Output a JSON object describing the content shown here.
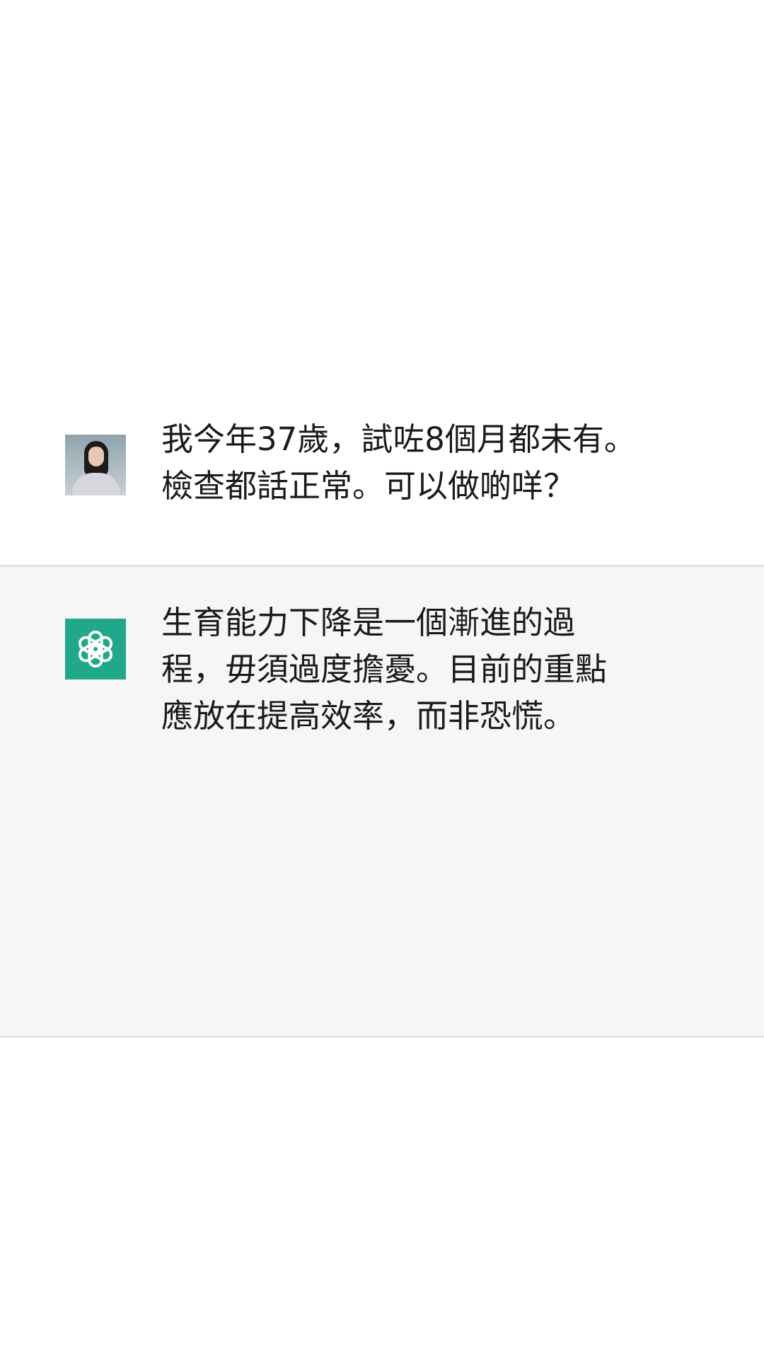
{
  "conversation": {
    "messages": [
      {
        "role": "user",
        "avatar": "user-photo-avatar",
        "text": "我今年37歲，試咗8個月都未有。\n檢查都話正常。可以做啲咩？"
      },
      {
        "role": "assistant",
        "avatar": "openai-logo-icon",
        "text": "生育能力下降是一個漸進的過\n程，毋須過度擔憂。目前的重點\n應放在提高效率，而非恐慌。"
      }
    ]
  },
  "colors": {
    "assistant_background": "#f6f6f6",
    "divider": "#e3e3e3",
    "bot_avatar": "#1fa889",
    "text": "#1a1a1a"
  }
}
